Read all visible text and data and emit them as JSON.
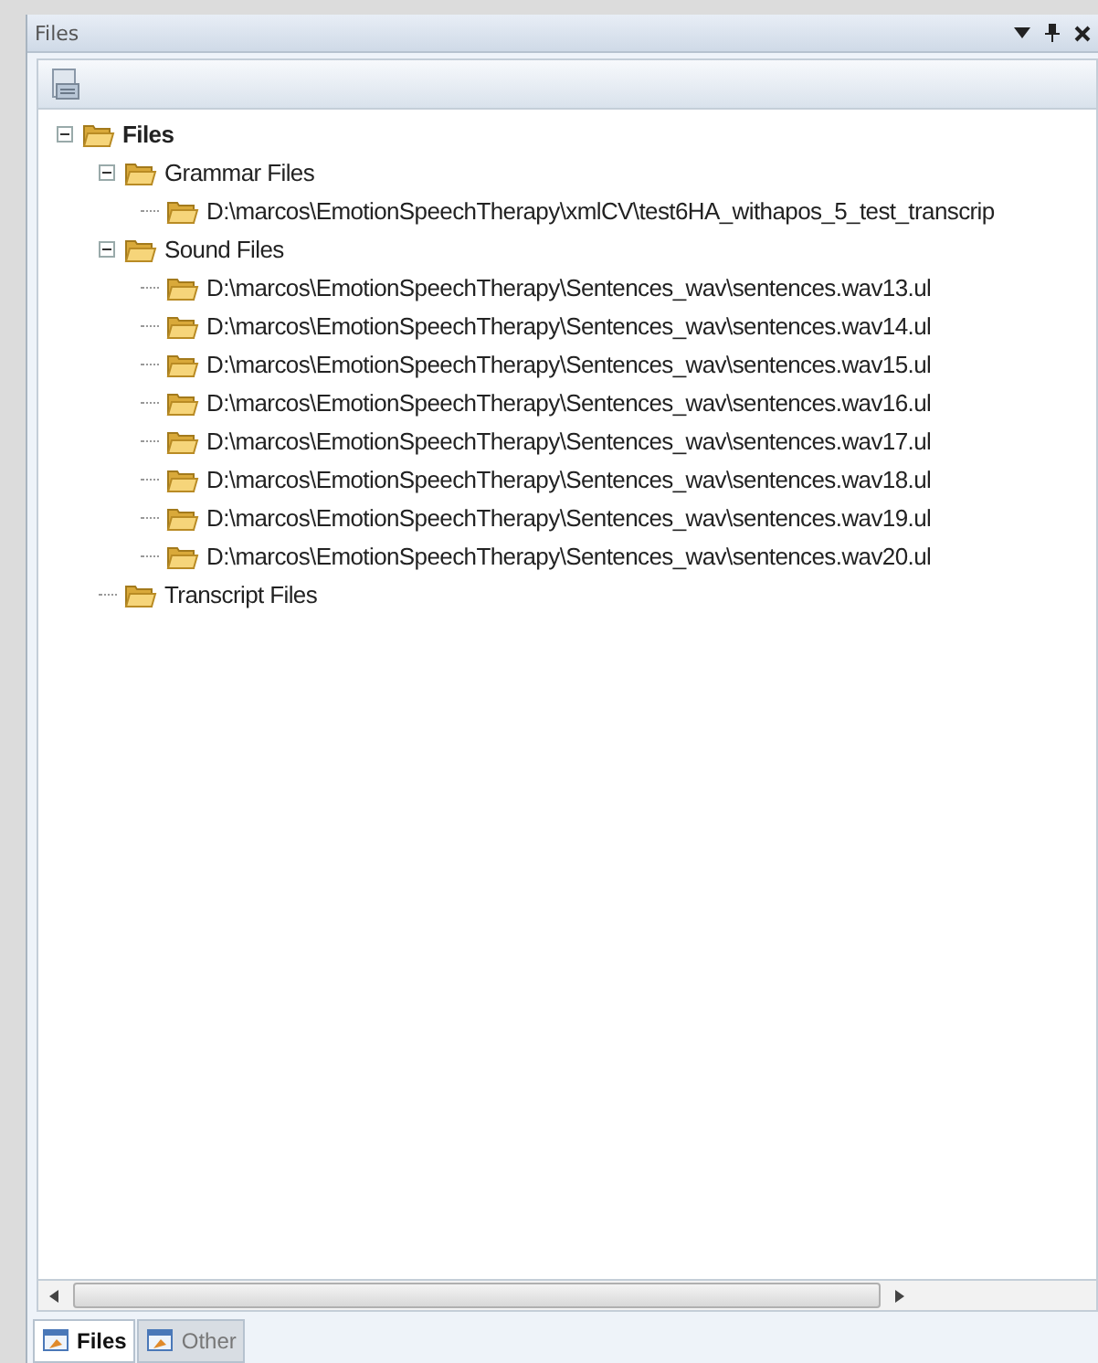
{
  "window": {
    "title": "Files"
  },
  "tree": [
    {
      "label": "Files",
      "expanded": true,
      "children": [
        {
          "label": "Grammar Files",
          "expanded": true,
          "children": [
            {
              "label": "D:\\marcos\\EmotionSpeechTherapy\\xmlCV\\test6HA_withapos_5_test_transcrip"
            }
          ]
        },
        {
          "label": "Sound Files",
          "expanded": true,
          "children": [
            {
              "label": "D:\\marcos\\EmotionSpeechTherapy\\Sentences_wav\\sentences.wav13.ul"
            },
            {
              "label": "D:\\marcos\\EmotionSpeechTherapy\\Sentences_wav\\sentences.wav14.ul"
            },
            {
              "label": "D:\\marcos\\EmotionSpeechTherapy\\Sentences_wav\\sentences.wav15.ul"
            },
            {
              "label": "D:\\marcos\\EmotionSpeechTherapy\\Sentences_wav\\sentences.wav16.ul"
            },
            {
              "label": "D:\\marcos\\EmotionSpeechTherapy\\Sentences_wav\\sentences.wav17.ul"
            },
            {
              "label": "D:\\marcos\\EmotionSpeechTherapy\\Sentences_wav\\sentences.wav18.ul"
            },
            {
              "label": "D:\\marcos\\EmotionSpeechTherapy\\Sentences_wav\\sentences.wav19.ul"
            },
            {
              "label": "D:\\marcos\\EmotionSpeechTherapy\\Sentences_wav\\sentences.wav20.ul"
            }
          ]
        },
        {
          "label": "Transcript Files"
        }
      ]
    }
  ],
  "tabs": [
    {
      "label": "Files",
      "selected": true
    },
    {
      "label": "Other",
      "selected": false
    }
  ]
}
